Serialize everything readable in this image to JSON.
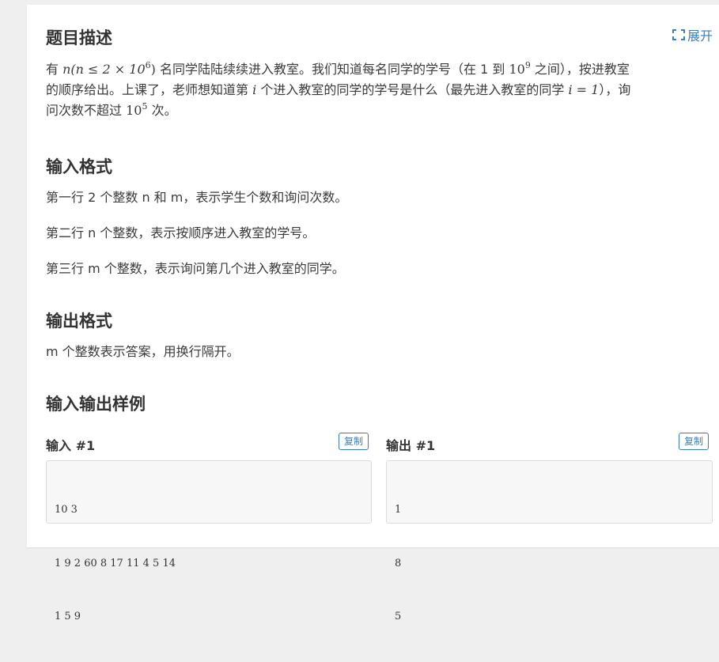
{
  "problem": {
    "title": "题目描述",
    "expand_label": "展开",
    "desc_line1_prefix": "有",
    "desc_line1_math": "n(n ≤ 2 × 10",
    "desc_line1_exp": "6",
    "desc_line1_close": ")",
    "desc_line1_text": "名同学陆陆续续进入教室。我们知道每名同学的学号（在 1 到",
    "desc_line1_math2": "10",
    "desc_line1_exp2": "9",
    "desc_line1_tail": "之间），按进教室",
    "desc_line2_text": "的顺序给出。上课了，老师想知道第",
    "desc_line2_var": "i",
    "desc_line2_mid": "个进入教室的同学的学号是什么（最先进入教室的同学",
    "desc_line2_eq": "i = 1",
    "desc_line2_tail": "），询",
    "desc_line3_text": "问次数不超过",
    "desc_line3_base": "10",
    "desc_line3_exp": "5",
    "desc_line3_tail": "次。"
  },
  "input_format": {
    "title": "输入格式",
    "lines": [
      "第一行 2 个整数 n 和 m，表示学生个数和询问次数。",
      "第二行 n 个整数，表示按顺序进入教室的学号。",
      "第三行 m 个整数，表示询问第几个进入教室的同学。"
    ]
  },
  "output_format": {
    "title": "输出格式",
    "lines": [
      "m 个整数表示答案，用换行隔开。"
    ]
  },
  "samples": {
    "title": "输入输出样例",
    "input_label": "输入 #1",
    "output_label": "输出 #1",
    "copy_label": "复制",
    "input_lines": [
      "10 3",
      "1 9 2 60 8 17 11 4 5 14",
      "1 5 9"
    ],
    "output_lines": [
      "1",
      "8",
      "5"
    ]
  },
  "colors": {
    "accent": "#3a7ebf",
    "background": "#efefef",
    "card": "#ffffff"
  }
}
